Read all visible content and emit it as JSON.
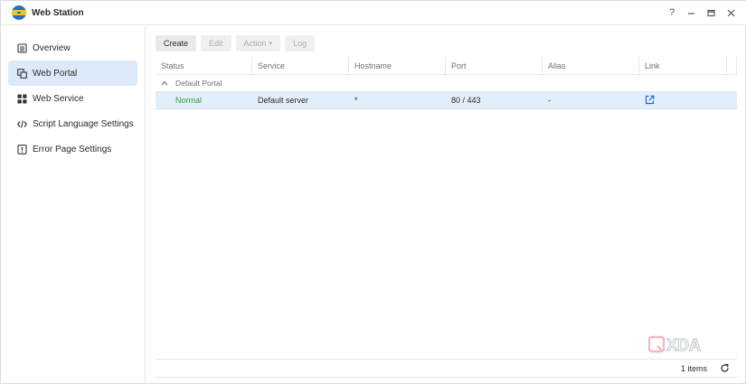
{
  "app": {
    "title": "Web Station",
    "logo_colors": {
      "blue": "#2d6fb7",
      "yellow": "#f2c230"
    }
  },
  "titlebar": {
    "help": "?",
    "minimize": "—",
    "maximize": "▭",
    "close": "✕"
  },
  "sidebar": {
    "items": [
      {
        "label": "Overview",
        "icon": "overview-list-icon",
        "active": false
      },
      {
        "label": "Web Portal",
        "icon": "web-portal-icon",
        "active": true
      },
      {
        "label": "Web Service",
        "icon": "web-service-grid-icon",
        "active": false
      },
      {
        "label": "Script Language Settings",
        "icon": "code-icon",
        "active": false
      },
      {
        "label": "Error Page Settings",
        "icon": "error-page-icon",
        "active": false
      }
    ]
  },
  "toolbar": {
    "create": "Create",
    "edit": "Edit",
    "action": "Action",
    "log": "Log"
  },
  "table": {
    "columns": [
      "Status",
      "Service",
      "Hostname",
      "Port",
      "Alias",
      "Link"
    ],
    "group": {
      "label": "Default Portal"
    },
    "rows": [
      {
        "status": "Normal",
        "service": "Default server",
        "hostname": "*",
        "port": "80 / 443",
        "alias": "-",
        "link_icon": "open-external-icon"
      }
    ]
  },
  "footer": {
    "items_count": "1 items"
  },
  "watermark": {
    "text": "XDA"
  },
  "colors": {
    "accent": "#1a6fc4",
    "selected_row": "#e2eefb",
    "status_normal": "#2ea43b",
    "active_nav": "#dbe9f8"
  }
}
